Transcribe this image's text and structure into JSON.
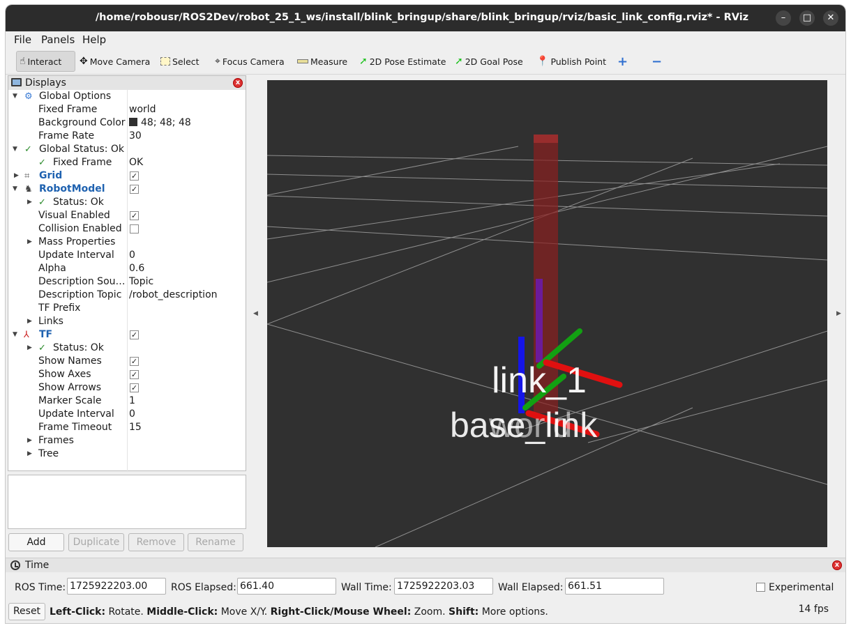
{
  "window": {
    "title": "/home/robousr/ROS2Dev/robot_25_1_ws/install/blink_bringup/share/blink_bringup/rviz/basic_link_config.rviz* - RViz",
    "minimize": "–",
    "maximize": "□",
    "close": "✕"
  },
  "menu": {
    "file": "File",
    "panels": "Panels",
    "help": "Help"
  },
  "toolbar": {
    "interact": "Interact",
    "move_camera": "Move Camera",
    "select": "Select",
    "focus_camera": "Focus Camera",
    "measure": "Measure",
    "pose_estimate": "2D Pose Estimate",
    "goal_pose": "2D Goal Pose",
    "publish_point": "Publish Point",
    "add_tool": "+",
    "remove_tool": "−"
  },
  "displays": {
    "title": "Displays",
    "global_options": "Global Options",
    "fixed_frame_label": "Fixed Frame",
    "fixed_frame_value": "world",
    "bg_color_label": "Background Color",
    "bg_color_value": "48; 48; 48",
    "bg_color_hex": "#303030",
    "frame_rate_label": "Frame Rate",
    "frame_rate_value": "30",
    "global_status": "Global Status: Ok",
    "gs_fixed_frame_label": "Fixed Frame",
    "gs_fixed_frame_value": "OK",
    "grid": "Grid",
    "robot_model": "RobotModel",
    "rm_status": "Status: Ok",
    "visual_enabled": "Visual Enabled",
    "collision_enabled": "Collision Enabled",
    "mass_properties": "Mass Properties",
    "update_interval_label": "Update Interval",
    "update_interval_value": "0",
    "alpha_label": "Alpha",
    "alpha_value": "0.6",
    "desc_source_label": "Description Sou…",
    "desc_source_value": "Topic",
    "desc_topic_label": "Description Topic",
    "desc_topic_value": "/robot_description",
    "tf_prefix": "TF Prefix",
    "links": "Links",
    "tf": "TF",
    "tf_status": "Status: Ok",
    "show_names": "Show Names",
    "show_axes": "Show Axes",
    "show_arrows": "Show Arrows",
    "marker_scale_label": "Marker Scale",
    "marker_scale_value": "1",
    "tf_update_interval_label": "Update Interval",
    "tf_update_interval_value": "0",
    "frame_timeout_label": "Frame Timeout",
    "frame_timeout_value": "15",
    "frames": "Frames",
    "tree": "Tree"
  },
  "buttons": {
    "add": "Add",
    "duplicate": "Duplicate",
    "remove": "Remove",
    "rename": "Rename"
  },
  "view": {
    "labels": {
      "link_1": "link_1",
      "base_link": "base_link",
      "world": "world"
    },
    "colors": {
      "background": "#303030",
      "x_axis": "#e01010",
      "y_axis": "#12a012",
      "z_axis": "#1515e8",
      "link_box": "#8a1f1f"
    }
  },
  "time": {
    "title": "Time",
    "ros_time_label": "ROS Time:",
    "ros_time_value": "1725922203.00",
    "ros_elapsed_label": "ROS Elapsed:",
    "ros_elapsed_value": "661.40",
    "wall_time_label": "Wall Time:",
    "wall_time_value": "1725922203.03",
    "wall_elapsed_label": "Wall Elapsed:",
    "wall_elapsed_value": "661.51",
    "experimental": "Experimental"
  },
  "status": {
    "reset": "Reset",
    "left_click": "Left-Click:",
    "rotate": " Rotate. ",
    "middle_click": "Middle-Click:",
    "move_xy": " Move X/Y. ",
    "right_click": "Right-Click/Mouse Wheel:",
    "zoom": " Zoom. ",
    "shift": "Shift:",
    "more": " More options.",
    "fps": "14 fps"
  }
}
